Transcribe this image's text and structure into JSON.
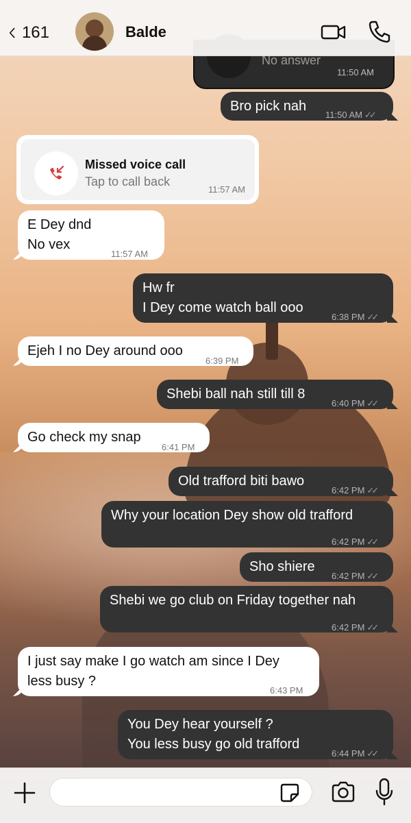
{
  "header": {
    "back_count": "161",
    "contact_name": "Balde"
  },
  "previous_call": {
    "status": "No answer",
    "time": "11:50 AM"
  },
  "missed_call": {
    "title": "Missed voice call",
    "subtitle": "Tap to call back",
    "time": "11:57 AM"
  },
  "messages": [
    {
      "dir": "out",
      "lines": [
        "Bro pick nah"
      ],
      "time": "11:50 AM"
    },
    {
      "dir": "in",
      "lines": [
        "E Dey dnd",
        "No vex"
      ],
      "time": "11:57 AM"
    },
    {
      "dir": "out",
      "lines": [
        "Hw fr",
        "I Dey come watch ball ooo"
      ],
      "time": "6:38 PM"
    },
    {
      "dir": "in",
      "lines": [
        "Ejeh I no Dey around ooo"
      ],
      "time": "6:39 PM"
    },
    {
      "dir": "out",
      "lines": [
        "Shebi ball nah still till 8"
      ],
      "time": "6:40 PM"
    },
    {
      "dir": "in",
      "lines": [
        "Go check my snap"
      ],
      "time": "6:41 PM"
    },
    {
      "dir": "out",
      "lines": [
        "Old trafford biti bawo"
      ],
      "time": "6:42 PM"
    },
    {
      "dir": "out",
      "lines": [
        "Why your location Dey show old trafford"
      ],
      "time": "6:42 PM"
    },
    {
      "dir": "out",
      "lines": [
        "Sho shiere"
      ],
      "time": "6:42 PM"
    },
    {
      "dir": "out",
      "lines": [
        "Shebi we go club on Friday together nah"
      ],
      "time": "6:42 PM"
    },
    {
      "dir": "in",
      "lines": [
        "I just say make I go watch am since I Dey",
        "less busy ?"
      ],
      "time": "6:43 PM"
    },
    {
      "dir": "out",
      "lines": [
        "You Dey hear yourself ?",
        "You less busy go old trafford"
      ],
      "time": "6:44 PM"
    }
  ],
  "composer": {
    "placeholder": ""
  },
  "icons": {
    "back": "chevron-left-icon",
    "video": "video-camera-icon",
    "phone": "phone-icon",
    "missed_call": "missed-call-icon",
    "plus": "plus-icon",
    "sticker": "sticker-icon",
    "camera": "camera-icon",
    "mic": "microphone-icon"
  },
  "colors": {
    "outgoing_bubble": "#333333",
    "incoming_bubble": "#ffffff",
    "missed_call_red": "#d93a3a"
  }
}
